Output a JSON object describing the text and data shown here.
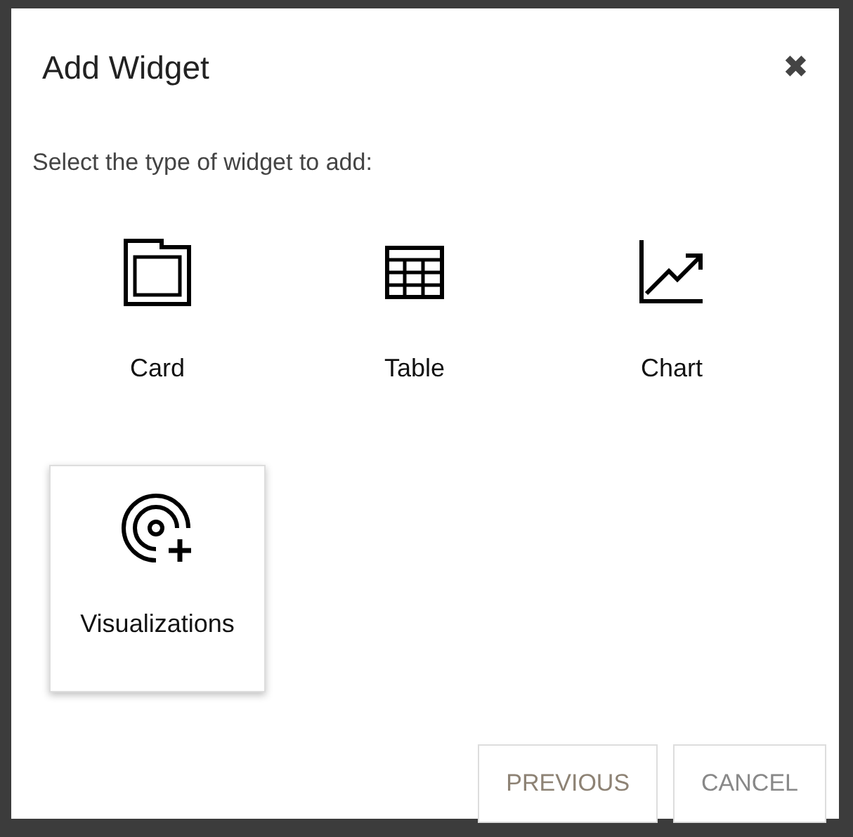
{
  "dialog": {
    "title": "Add Widget",
    "close": "✖",
    "prompt": "Select the type of widget to add:",
    "widgets": [
      {
        "kind": "card",
        "label": "Card",
        "highlighted": false
      },
      {
        "kind": "table",
        "label": "Table",
        "highlighted": false
      },
      {
        "kind": "chart",
        "label": "Chart",
        "highlighted": false
      },
      {
        "kind": "visualizations",
        "label": "Visualizations",
        "highlighted": true
      }
    ],
    "buttons": [
      {
        "label": "PREVIOUS",
        "kind": "previous"
      },
      {
        "label": "CANCEL",
        "kind": "cancel"
      }
    ]
  }
}
